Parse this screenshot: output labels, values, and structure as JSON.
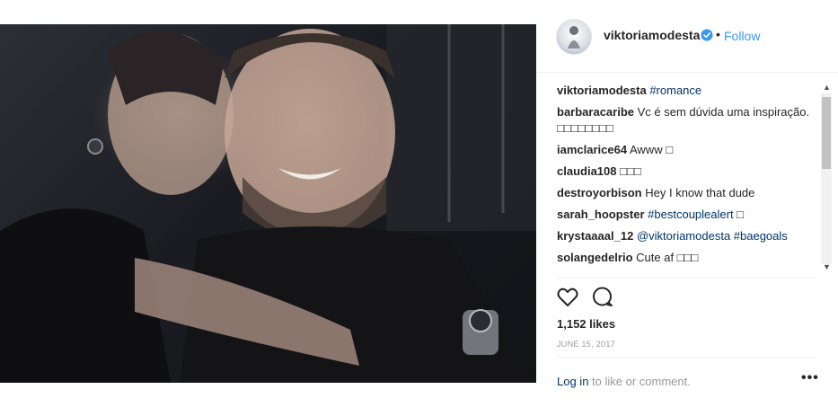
{
  "post": {
    "image_alt": "selfie photo",
    "author": {
      "username": "viktoriamodesta",
      "follow_label": "Follow",
      "separator": "•",
      "verified": true
    }
  },
  "comments": [
    {
      "user": "viktoriamodesta",
      "text": "",
      "tag": "#romance"
    },
    {
      "user": "barbaracaribe",
      "text": "Vc é sem dúvida uma inspiração. □□□□□□□□",
      "tag": ""
    },
    {
      "user": "iamclarice64",
      "text": "Awww □",
      "tag": ""
    },
    {
      "user": "claudia108",
      "text": "□□□",
      "tag": ""
    },
    {
      "user": "destroyorbison",
      "text": "Hey I know that dude",
      "tag": ""
    },
    {
      "user": "sarah_hoopster",
      "text": "",
      "tag": "#bestcouplealert □"
    },
    {
      "user": "krystaaaal_12",
      "text": "",
      "tag": "@viktoriamodesta #baegoals"
    },
    {
      "user": "solangedelrio",
      "text": "Cute af □□□",
      "tag": ""
    }
  ],
  "stats": {
    "likes": "1,152 likes",
    "date": "JUNE 15, 2017"
  },
  "footer": {
    "login_label": "Log in",
    "login_suffix": " to like or comment.",
    "more_label": "•••"
  },
  "icons": {
    "like": "heart-icon",
    "comment": "comment-bubble-icon",
    "verified": "verified-badge-icon",
    "more": "more-options-icon"
  },
  "colors": {
    "link": "#003569",
    "follow": "#3897f0",
    "text": "#262626",
    "muted": "#999999"
  }
}
